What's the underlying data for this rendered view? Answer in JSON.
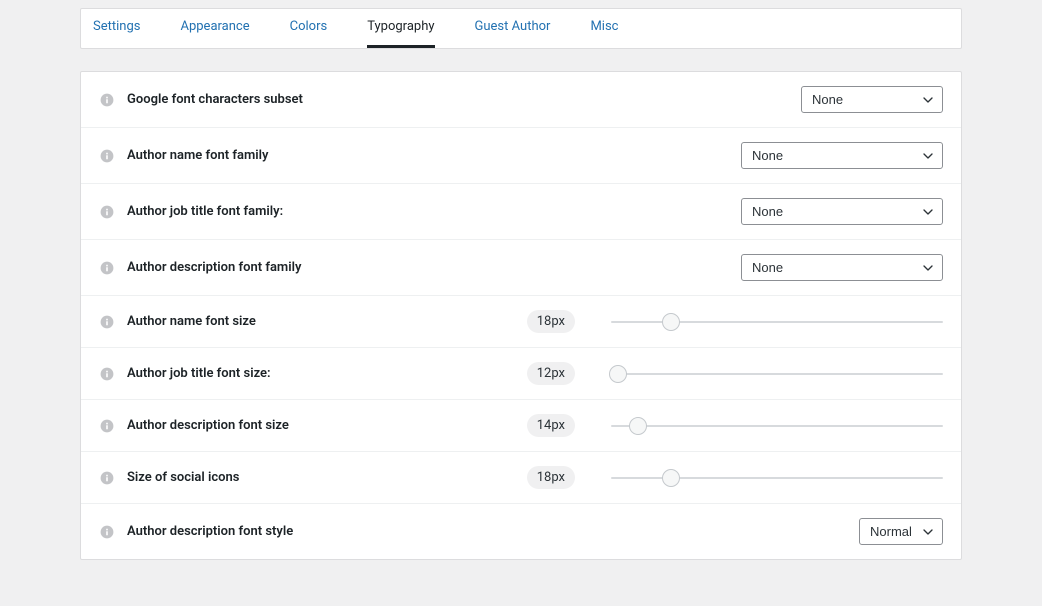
{
  "tabs": {
    "settings": "Settings",
    "appearance": "Appearance",
    "colors": "Colors",
    "typography": "Typography",
    "guest_author": "Guest Author",
    "misc": "Misc"
  },
  "options": {
    "none": "None",
    "normal": "Normal"
  },
  "rows": {
    "google_subset": {
      "label": "Google font characters subset",
      "value": "None"
    },
    "author_name_family": {
      "label": "Author name font family",
      "value": "None"
    },
    "author_job_family": {
      "label": "Author job title font family:",
      "value": "None"
    },
    "author_desc_family": {
      "label": "Author description font family",
      "value": "None"
    },
    "author_name_size": {
      "label": "Author name font size",
      "badge": "18px",
      "percent": 18
    },
    "author_job_size": {
      "label": "Author job title font size:",
      "badge": "12px",
      "percent": 2
    },
    "author_desc_size": {
      "label": "Author description font size",
      "badge": "14px",
      "percent": 8
    },
    "social_icon_size": {
      "label": "Size of social icons",
      "badge": "18px",
      "percent": 18
    },
    "author_desc_style": {
      "label": "Author description font style",
      "value": "Normal"
    }
  }
}
